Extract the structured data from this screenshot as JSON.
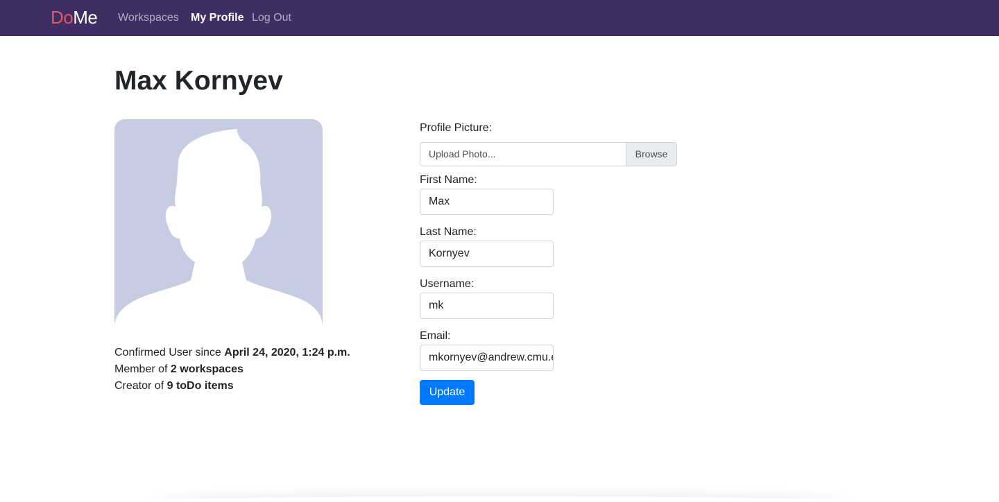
{
  "navbar": {
    "brand_do": "Do",
    "brand_me": "Me",
    "links": [
      {
        "label": "Workspaces"
      },
      {
        "label": "My Profile"
      },
      {
        "label": "Log Out"
      }
    ],
    "background": "#3f2e63"
  },
  "profile": {
    "name": "Max Kornyev",
    "stats": {
      "confirmed_prefix": "Confirmed User since ",
      "confirmed_value": "April 24, 2020, 1:24 p.m.",
      "member_prefix": "Member of ",
      "member_value": "2 workspaces",
      "creator_prefix": "Creator of ",
      "creator_value": "9 toDo items"
    }
  },
  "form": {
    "picture_label": "Profile Picture:",
    "picture_placeholder": "Upload Photo...",
    "browse_label": "Browse",
    "first_name_label": "First Name:",
    "first_name_value": "Max",
    "last_name_label": "Last Name:",
    "last_name_value": "Kornyev",
    "username_label": "Username:",
    "username_value": "mk",
    "email_label": "Email:",
    "email_value": "mkornyev@andrew.cmu.edu",
    "update_label": "Update",
    "accent": "#007bff"
  }
}
